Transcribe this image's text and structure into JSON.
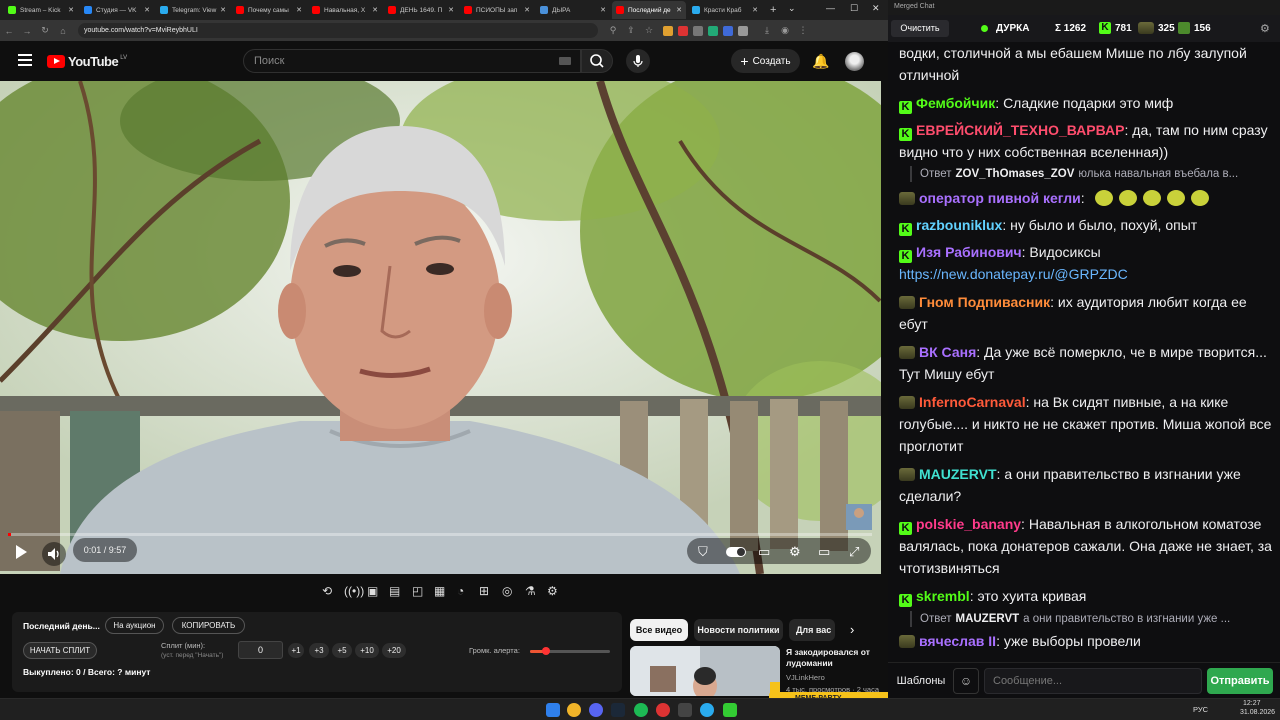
{
  "browser": {
    "tabs": [
      {
        "label": "Stream – Kick",
        "color": "#53fc18"
      },
      {
        "label": "Студия — VK",
        "color": "#2787f5"
      },
      {
        "label": "Telegram: View",
        "color": "#2aabee"
      },
      {
        "label": "Почему самы",
        "color": "#ff0000"
      },
      {
        "label": "Навальная, Х",
        "color": "#ff0000"
      },
      {
        "label": "ДЕНЬ 1649. П",
        "color": "#ff0000"
      },
      {
        "label": "ПСИОПЫ зап",
        "color": "#ff0000"
      },
      {
        "label": "ДЫРА",
        "color": "#4a90d9"
      },
      {
        "label": "Последний де",
        "color": "#ff0000"
      },
      {
        "label": "Красти Краб",
        "color": "#2aabee"
      }
    ],
    "active_tab": 8,
    "url": "youtube.com/watch?v=MviReybhULI"
  },
  "youtube": {
    "logo": "YouTube",
    "region": "LV",
    "search_placeholder": "Поиск",
    "create_label": "Создать",
    "player": {
      "time": "0:01 / 9:57",
      "progress_fraction": 0.002
    }
  },
  "panel": {
    "title": "Последний день...",
    "auction_btn": "На аукцион",
    "copy_btn": "КОПИРОВАТЬ",
    "split_btn": "НАЧАТЬ СПЛИТ",
    "split_label": "Сплит (мин):",
    "split_hint": "(уст. перед \"Начать\")",
    "split_value": "0",
    "increments": [
      "+1",
      "+3",
      "+5",
      "+10",
      "+20"
    ],
    "volume_label": "Громк. алерта:",
    "volume_fraction": 0.2,
    "summary": "Выкуплено: 0 / Всего: ? минут"
  },
  "related": {
    "chips": [
      "Все видео",
      "Новости политики",
      "Для вас"
    ],
    "video_title": "Я закодировался от лудомании",
    "channel": "VJLinkHero",
    "meta": "4 тыс. просмотров · 2 часа назад"
  },
  "taskbar": {
    "lang": "РУС",
    "time": "12:27",
    "date": "31.08.2026"
  },
  "chat": {
    "window_title": "Merged Chat",
    "clear_btn": "Очистить",
    "stream_name": "ДУРКА",
    "total": "Σ 1262",
    "kick_count": "781",
    "vk_count": "325",
    "other_count": "156",
    "messages": [
      {
        "kind": "msg",
        "name": "",
        "color": "#efeff1",
        "badge": "none",
        "text": "водки, столичной а мы ебашем Мише по лбу залупой отличной"
      },
      {
        "kind": "msg",
        "name": "Фембойчик",
        "color": "#53fc18",
        "badge": "kick",
        "text": "Сладкие подарки это миф"
      },
      {
        "kind": "msg",
        "name": "ЕВРЕЙСКИЙ_ТЕХНО_ВАРВАР",
        "color": "#ff4d6d",
        "badge": "kick",
        "text": "да, там по ним сразу видно что у них собственная вселенная))"
      },
      {
        "kind": "reply",
        "prefix": "Ответ",
        "name": "ZOV_ThOmases_ZOV",
        "text": "юлька навальная въебала в..."
      },
      {
        "kind": "msg",
        "name": "оператор пивной кегли",
        "color": "#a970ff",
        "badge": "gold",
        "text": ""
      },
      {
        "kind": "msg",
        "name": "razbouniklux",
        "color": "#62d2ff",
        "badge": "kick",
        "text": "ну было и было, похуй, опыт"
      },
      {
        "kind": "msg",
        "name": "Изя Рабинович",
        "color": "#a970ff",
        "badge": "kick",
        "text": "Видосиксы",
        "link": "https://new.donatepay.ru/@GRPZDC"
      },
      {
        "kind": "msg",
        "name": "Гном Подпивасник",
        "color": "#ff8c3a",
        "badge": "gold",
        "text": "их аудитория любит когда ее ебут"
      },
      {
        "kind": "msg",
        "name": "ВК Саня",
        "color": "#a970ff",
        "badge": "gold",
        "text": "Да уже всё померкло, че в мире творится... Тут Мишу ебут"
      },
      {
        "kind": "msg",
        "name": "InfernoCarnaval",
        "color": "#ff5a3a",
        "badge": "gold",
        "text": "на Вк сидят пивные, а на кике голубые.... и никто не не скажет против. Миша жопой все проглотит"
      },
      {
        "kind": "msg",
        "name": "MAUZERVT",
        "color": "#40e0d0",
        "badge": "gold",
        "text": "а они правительство в изгнании уже сделали?"
      },
      {
        "kind": "msg",
        "name": "polskie_banany",
        "color": "#ff3b8b",
        "badge": "kick",
        "text": "Навальная в алкогольном коматозе валялась, пока донатеров сажали. Она даже не знает, за чтотизвиняться"
      },
      {
        "kind": "msg",
        "name": "skrembl",
        "color": "#53fc18",
        "badge": "kick",
        "text": "это хуита кривая"
      },
      {
        "kind": "reply",
        "prefix": "Ответ",
        "name": "MAUZERVT",
        "text": "а они правительство в изгнании уже ..."
      },
      {
        "kind": "msg",
        "name": "вячеслав II",
        "color": "#a970ff",
        "badge": "gold",
        "text": "уже выборы провели"
      }
    ],
    "templates_btn": "Шаблоны",
    "input_placeholder": "Сообщение...",
    "send_btn": "Отправить"
  }
}
